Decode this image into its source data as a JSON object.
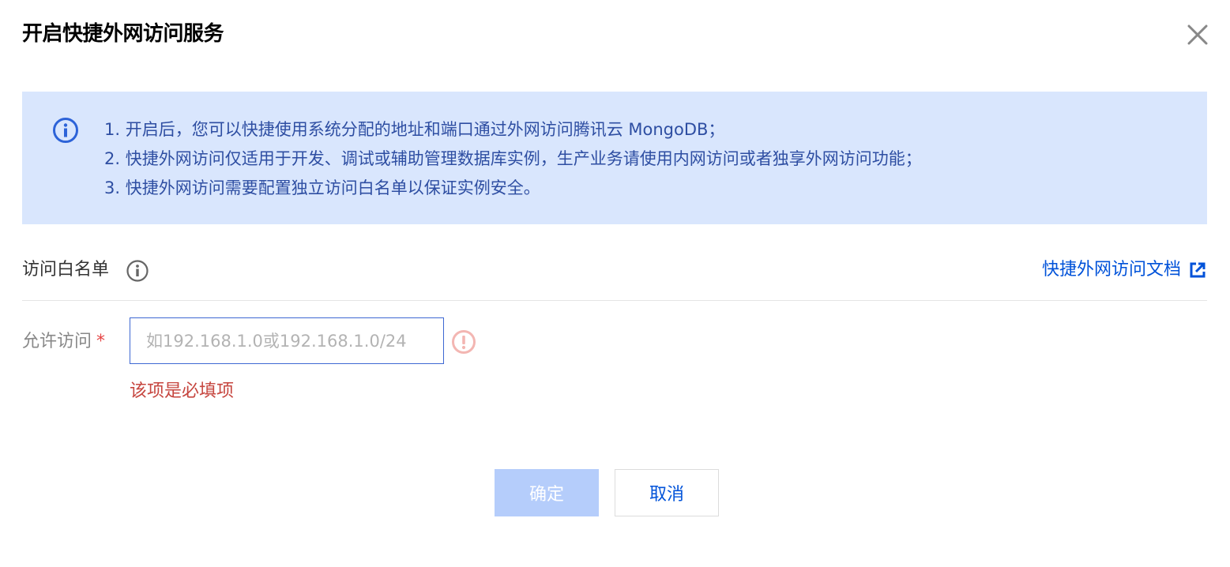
{
  "dialog": {
    "title": "开启快捷外网访问服务",
    "close_icon": "close-icon"
  },
  "notice": {
    "icon": "info-circle-icon",
    "lines": [
      "1. 开启后，您可以快捷使用系统分配的地址和端口通过外网访问腾讯云 MongoDB；",
      "2. 快捷外网访问仅适用于开发、调试或辅助管理数据库实例，生产业务请使用内网访问或者独享外网访问功能；",
      "3. 快捷外网访问需要配置独立访问白名单以保证实例安全。"
    ]
  },
  "whitelist": {
    "label": "访问白名单",
    "info_icon": "info-circle-icon",
    "doc_link": "快捷外网访问文档",
    "doc_link_icon": "external-link-icon"
  },
  "form": {
    "allow_label": "允许访问",
    "required_mark": "*",
    "ip_input": {
      "value": "",
      "placeholder": "如192.168.1.0或192.168.1.0/24"
    },
    "error_icon": "error-circle-icon",
    "error_text": "该项是必填项"
  },
  "buttons": {
    "confirm": "确定",
    "cancel": "取消"
  },
  "colors": {
    "notice_bg": "#d9e6fd",
    "notice_text": "#2e4ea2",
    "link": "#0052d9",
    "input_border_focus": "#3e68d3",
    "error": "#c6463f",
    "required": "#e54545",
    "confirm_disabled_bg": "#b5cdfb"
  }
}
